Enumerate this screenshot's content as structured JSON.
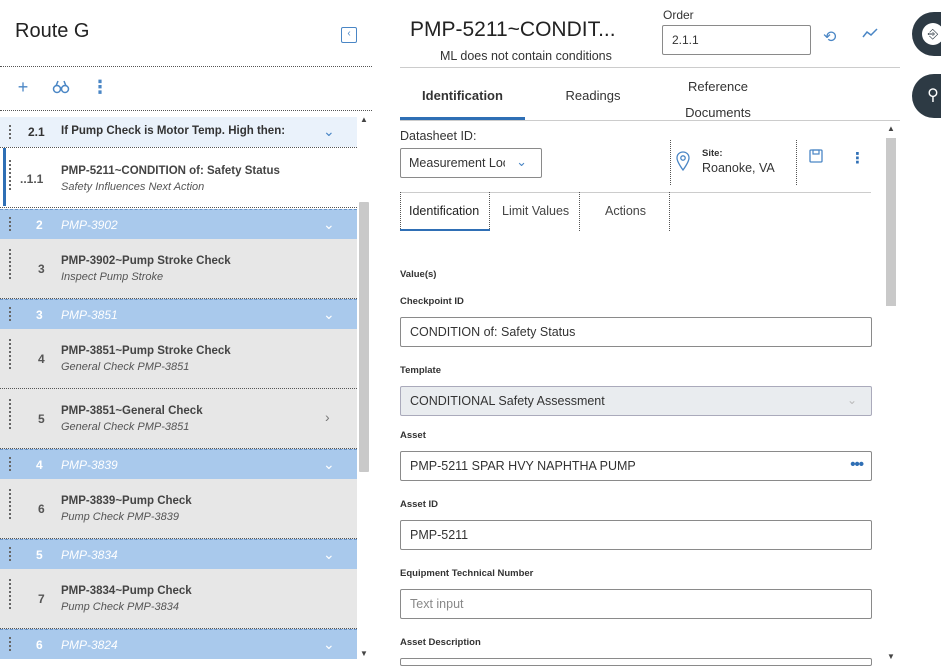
{
  "left": {
    "title": "Route G",
    "collapse_icon": "collapse-left-icon",
    "toolbar": {
      "add_icon": "+",
      "search_icon": "binoculars",
      "more_icon": "⋮"
    },
    "rows": [
      {
        "kind": "condition",
        "num": "2.1",
        "label": "If Pump Check is Motor Temp. High then:"
      },
      {
        "kind": "item",
        "num": "1.1",
        "title": "PMP-5211~CONDITION of: Safety Status",
        "sub": "Safety Influences Next Action",
        "active": true
      },
      {
        "kind": "header",
        "num": "2",
        "label": "PMP-3902"
      },
      {
        "kind": "item",
        "num": "3",
        "title": "PMP-3902~Pump Stroke Check",
        "sub": "Inspect Pump Stroke"
      },
      {
        "kind": "header",
        "num": "3",
        "label": "PMP-3851"
      },
      {
        "kind": "item",
        "num": "4",
        "title": "PMP-3851~Pump Stroke Check",
        "sub": "General Check PMP-3851"
      },
      {
        "kind": "item",
        "num": "5",
        "title": "PMP-3851~General Check",
        "sub": "General Check PMP-3851",
        "has_arrow": true
      },
      {
        "kind": "header",
        "num": "4",
        "label": "PMP-3839"
      },
      {
        "kind": "item",
        "num": "6",
        "title": "PMP-3839~Pump Check",
        "sub": "Pump Check PMP-3839"
      },
      {
        "kind": "header",
        "num": "5",
        "label": "PMP-3834"
      },
      {
        "kind": "item",
        "num": "7",
        "title": "PMP-3834~Pump Check",
        "sub": "Pump Check PMP-3834"
      },
      {
        "kind": "header",
        "num": "6",
        "label": "PMP-3824"
      }
    ]
  },
  "record": {
    "title": "PMP-5211~CONDIT...",
    "subtitle": "ML does not contain conditions",
    "order_label": "Order",
    "order_value": "2.1.1",
    "tabs": [
      "Identification",
      "Readings",
      "Reference Documents"
    ],
    "datasheet_label": "Datasheet ID:",
    "datasheet_value": "Measurement Location",
    "site_label": "Site:",
    "site_value": "Roanoke, VA",
    "subtabs": [
      "Identification",
      "Limit Values",
      "Actions"
    ],
    "fields": {
      "section": "Value(s)",
      "checkpoint_id_label": "Checkpoint ID",
      "checkpoint_id_value": "CONDITION of: Safety Status",
      "template_label": "Template",
      "template_value": "CONDITIONAL Safety Assessment",
      "asset_label": "Asset",
      "asset_value": "PMP-5211 SPAR HVY NAPHTHA PUMP",
      "asset_id_label": "Asset ID",
      "asset_id_value": "PMP-5211",
      "etn_label": "Equipment Technical Number",
      "etn_placeholder": "Text input",
      "asset_desc_label": "Asset Description"
    }
  },
  "colors": {
    "accent": "#2f6fb5",
    "header_row": "#a9c9ec",
    "item_row": "#e7e7e7",
    "side_button": "#2d3a44"
  }
}
